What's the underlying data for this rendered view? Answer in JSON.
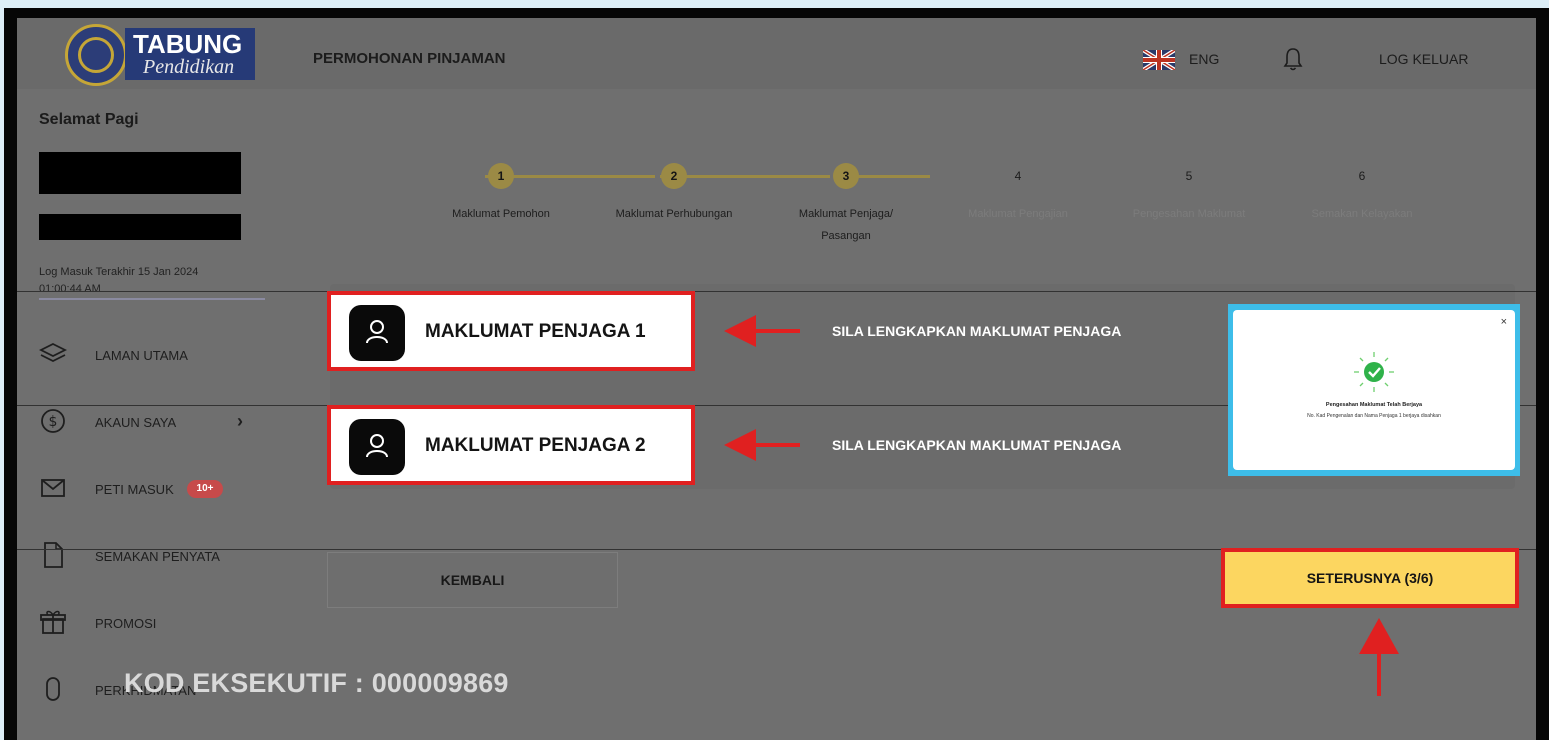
{
  "app": {
    "logo_word1": "TABUNG",
    "logo_word2": "Pendidikan",
    "page_title": "PERMOHONAN PINJAMAN",
    "language": "ENG",
    "logout_label": "LOG KELUAR"
  },
  "sidebar": {
    "greeting": "Selamat Pagi",
    "last_login_line1": "Log Masuk Terakhir 15 Jan 2024",
    "last_login_line2": "01:00:44 AM",
    "items": [
      {
        "label": "LAMAN UTAMA",
        "icon": "layers-icon"
      },
      {
        "label": "AKAUN SAYA",
        "icon": "dollar-circle-icon",
        "chevron": "›"
      },
      {
        "label": "PETI MASUK",
        "icon": "mail-icon",
        "badge": "10+"
      },
      {
        "label": "SEMAKAN PENYATA",
        "icon": "document-icon"
      },
      {
        "label": "PROMOSI",
        "icon": "gift-icon"
      },
      {
        "label": "PERKHIDMATAN",
        "icon": "mouse-icon"
      }
    ]
  },
  "stepper": {
    "steps": [
      {
        "number": "1",
        "label": "Maklumat Pemohon",
        "label2": "",
        "state": "done"
      },
      {
        "number": "2",
        "label": "Maklumat Perhubungan",
        "label2": "",
        "state": "done"
      },
      {
        "number": "3",
        "label": "Maklumat Penjaga/",
        "label2": "Pasangan",
        "state": "current"
      },
      {
        "number": "4",
        "label": "Maklumat Pengajian",
        "label2": "",
        "state": "todo"
      },
      {
        "number": "5",
        "label": "Pengesahan Maklumat",
        "label2": "",
        "state": "todo"
      },
      {
        "number": "6",
        "label": "Semakan Kelayakan",
        "label2": "",
        "state": "todo"
      }
    ]
  },
  "guardians": [
    {
      "label": "MAKLUMAT PENJAGA 1",
      "note": "SILA LENGKAPKAN MAKLUMAT PENJAGA"
    },
    {
      "label": "MAKLUMAT PENJAGA 2",
      "note": "SILA LENGKAPKAN MAKLUMAT PENJAGA"
    }
  ],
  "popup": {
    "close": "×",
    "title": "Pengesahan Maklumat Telah Berjaya",
    "message": "No. Kad Pengenalan dan Nama Penjaga 1 berjaya disahkan"
  },
  "buttons": {
    "back": "KEMBALI",
    "next": "SETERUSNYA (3/6)"
  },
  "footer_code": "KOD EKSEKUTIF : 000009869",
  "colors": {
    "highlight_red": "#e02020",
    "next_button": "#fcd660",
    "popup_border": "#3dbde9",
    "step_done": "#9b8a45",
    "success_green": "#2fb24a"
  }
}
